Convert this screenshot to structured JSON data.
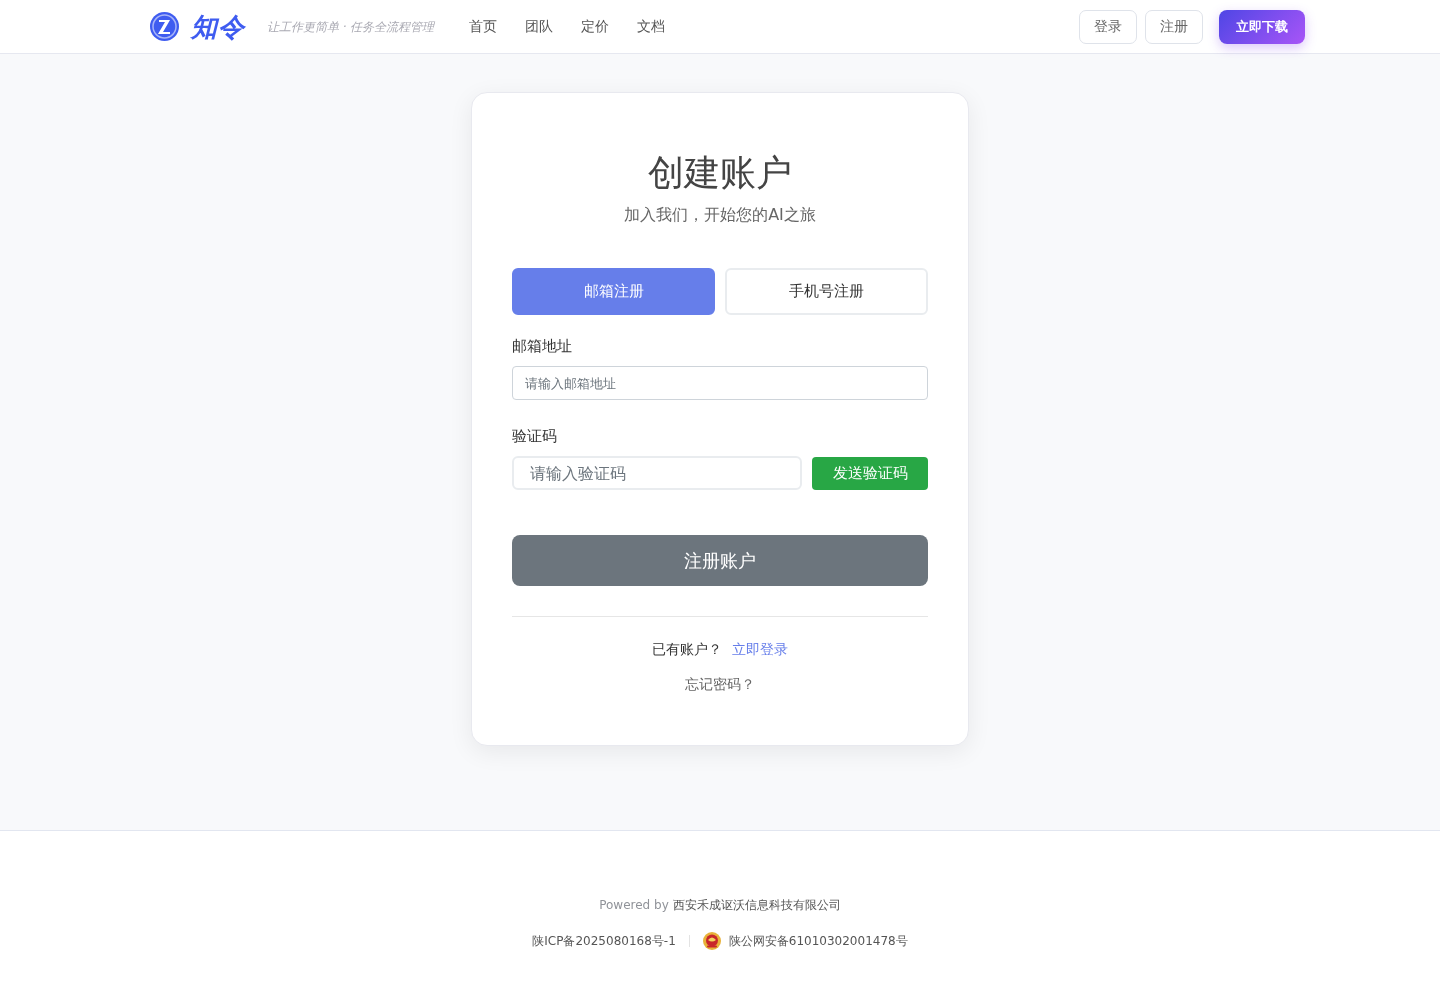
{
  "navbar": {
    "brand": "知令",
    "tagline": "让工作更简单 · 任务全流程管理",
    "links": [
      "首页",
      "团队",
      "定价",
      "文档"
    ],
    "buttons": [
      {
        "label": "登录",
        "kind": "outline"
      },
      {
        "label": "注册",
        "kind": "outline"
      },
      {
        "label": "立即下载",
        "kind": "primary"
      }
    ]
  },
  "card": {
    "title": "创建账户",
    "subtitle": "加入我们，开始您的AI之旅",
    "tabs": [
      {
        "label": "邮箱注册",
        "selected": true
      },
      {
        "label": "手机号注册",
        "selected": false
      }
    ],
    "fields": [
      {
        "kind": "plain",
        "label": "邮箱地址",
        "placeholder": "请输入邮箱地址"
      },
      {
        "kind": "code",
        "label": "验证码",
        "placeholder": "请输入验证码",
        "button": "发送验证码"
      }
    ],
    "submit": "注册账户",
    "login_prompt": "已有账户？",
    "login_link": "立即登录",
    "forgot": "忘记密码？"
  },
  "footer": {
    "powered_prefix": "Powered by",
    "company": "西安禾成讴沃信息科技有限公司",
    "icp": "陕ICP备2025080168号-1",
    "police": "陕公网安备61010302001478号"
  }
}
